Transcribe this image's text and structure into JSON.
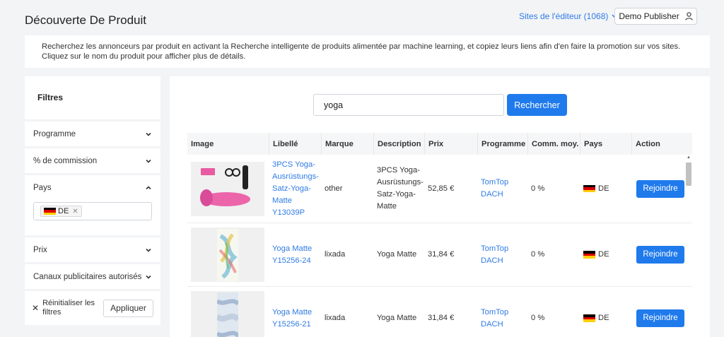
{
  "header": {
    "title": "Découverte De Produit",
    "sites_link": "Sites de l'éditeur (1068)",
    "publisher": "Demo Publisher"
  },
  "intro": "Recherchez les annonceurs par produit en activant la Recherche intelligente de produits alimentée par machine learning, et copiez leurs liens afin d'en faire la promotion sur vos sites. Cliquez sur le nom du produit pour afficher plus de détails.",
  "filters": {
    "title": "Filtres",
    "items": [
      {
        "label": "Programme"
      },
      {
        "label": "% de commission"
      },
      {
        "label": "Pays"
      },
      {
        "label": "Prix"
      },
      {
        "label": "Canaux publicitaires autorisés"
      }
    ],
    "country_tag": "DE",
    "reset_label": "Réinitialiser les filtres",
    "apply_label": "Appliquer"
  },
  "search": {
    "value": "yoga",
    "button": "Rechercher"
  },
  "table": {
    "headers": [
      "Image",
      "Libellé",
      "Marque",
      "Description",
      "Prix",
      "Programme",
      "Comm. moy.",
      "Pays",
      "Action"
    ],
    "rows": [
      {
        "title": "3PCS Yoga-Ausrüstungs-Satz-Yoga-Matte Y13039P",
        "brand": "other",
        "description": "3PCS Yoga-Ausrüstungs-Satz-Yoga-Matte",
        "price": "52,85 €",
        "program": "TomTop DACH",
        "commission": "0 %",
        "country": "DE",
        "action": "Rejoindre"
      },
      {
        "title": "Yoga Matte Y15256-24",
        "brand": "lixada",
        "description": "Yoga Matte",
        "price": "31,84 €",
        "program": "TomTop DACH",
        "commission": "0 %",
        "country": "DE",
        "action": "Rejoindre"
      },
      {
        "title": "Yoga Matte Y15256-21",
        "brand": "lixada",
        "description": "Yoga Matte",
        "price": "31,84 €",
        "program": "TomTop DACH",
        "commission": "0 %",
        "country": "DE",
        "action": "Rejoindre"
      }
    ]
  },
  "colors": {
    "accent": "#1f7aec",
    "link": "#2f7be5",
    "background": "#f3f4f6"
  }
}
